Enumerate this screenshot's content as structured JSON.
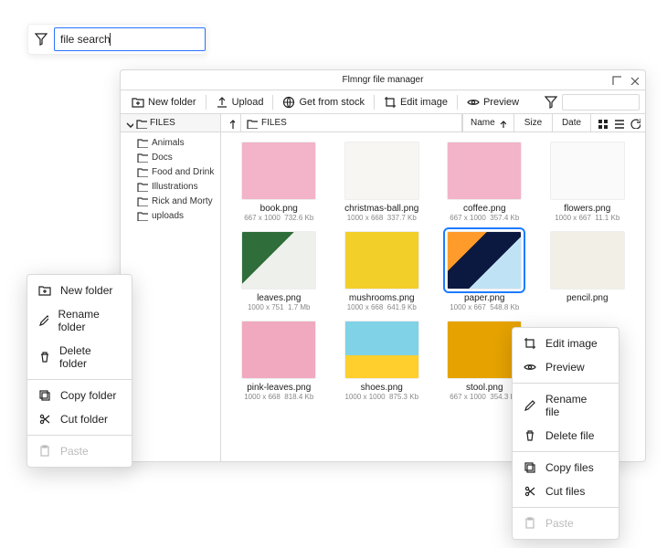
{
  "search": {
    "value": "file search"
  },
  "window": {
    "title": "Flmngr file manager",
    "toolbar": {
      "new_folder": "New folder",
      "upload": "Upload",
      "stock": "Get from stock",
      "edit_image": "Edit image",
      "preview": "Preview"
    },
    "tree": {
      "root": "FILES",
      "items": [
        "Animals",
        "Docs",
        "Food and Drink",
        "Illustrations",
        "Rick and Morty",
        "uploads"
      ]
    },
    "crumb": {
      "root": "FILES"
    },
    "columns": {
      "name": "Name",
      "size": "Size",
      "date": "Date"
    },
    "files": [
      {
        "name": "book.png",
        "dim": "667 x 1000",
        "size": "732.6 Kb",
        "css": "c-pink"
      },
      {
        "name": "christmas-ball.png",
        "dim": "1000 x 668",
        "size": "337.7 Kb",
        "css": "c-white"
      },
      {
        "name": "coffee.png",
        "dim": "667 x 1000",
        "size": "357.4 Kb",
        "css": "c-pink"
      },
      {
        "name": "flowers.png",
        "dim": "1000 x 667",
        "size": "11.1 Kb",
        "css": "c-flowers"
      },
      {
        "name": "leaves.png",
        "dim": "1000 x 751",
        "size": "1.7 Mb",
        "css": "c-green"
      },
      {
        "name": "mushrooms.png",
        "dim": "1000 x 668",
        "size": "641.9 Kb",
        "css": "c-yellow"
      },
      {
        "name": "paper.png",
        "dim": "1000 x 667",
        "size": "548.8 Kb",
        "css": "c-paper",
        "selected": true
      },
      {
        "name": "pencil.png",
        "dim": "",
        "size": "",
        "css": "c-pencil"
      },
      {
        "name": "pink-leaves.png",
        "dim": "1000 x 668",
        "size": "818.4 Kb",
        "css": "c-pinkplant"
      },
      {
        "name": "shoes.png",
        "dim": "1000 x 1000",
        "size": "875.3 Kb",
        "css": "c-shoes"
      },
      {
        "name": "stool.png",
        "dim": "667 x 1000",
        "size": "354.3 Kb",
        "css": "c-stool"
      }
    ]
  },
  "folder_menu": {
    "items": [
      {
        "label": "New folder",
        "icon": "folder-plus"
      },
      {
        "label": "Rename folder",
        "icon": "pencil"
      },
      {
        "label": "Delete folder",
        "icon": "trash"
      },
      {
        "sep": true
      },
      {
        "label": "Copy folder",
        "icon": "copy"
      },
      {
        "label": "Cut folder",
        "icon": "scissors"
      },
      {
        "sep": true
      },
      {
        "label": "Paste",
        "icon": "clipboard",
        "disabled": true
      }
    ]
  },
  "file_menu": {
    "items": [
      {
        "label": "Edit image",
        "icon": "crop"
      },
      {
        "label": "Preview",
        "icon": "eye"
      },
      {
        "sep": true
      },
      {
        "label": "Rename file",
        "icon": "pencil"
      },
      {
        "label": "Delete file",
        "icon": "trash"
      },
      {
        "sep": true
      },
      {
        "label": "Copy files",
        "icon": "copy"
      },
      {
        "label": "Cut files",
        "icon": "scissors"
      },
      {
        "sep": true
      },
      {
        "label": "Paste",
        "icon": "clipboard",
        "disabled": true
      }
    ]
  }
}
